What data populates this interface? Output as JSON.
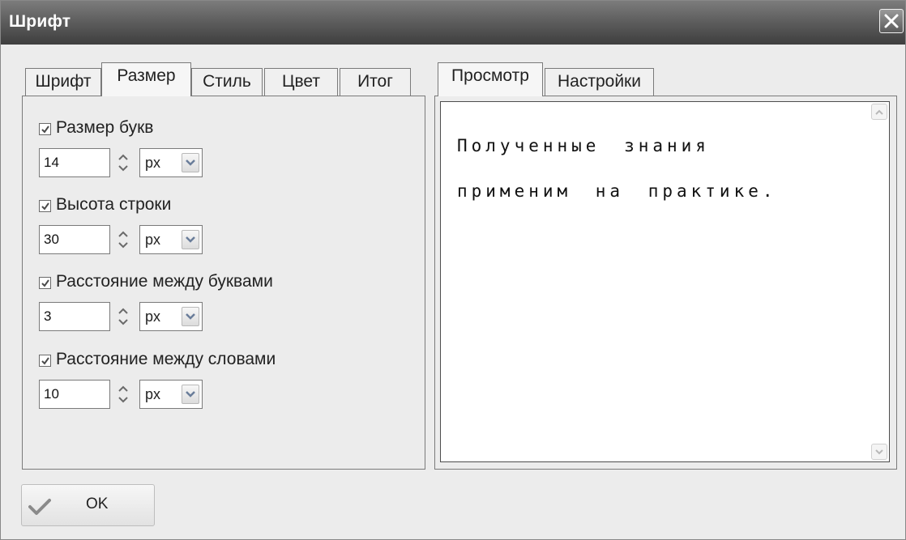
{
  "window": {
    "title": "Шрифт"
  },
  "left_tabs": [
    {
      "label": "Шрифт",
      "active": false
    },
    {
      "label": "Размер",
      "active": true
    },
    {
      "label": "Стиль",
      "active": false
    },
    {
      "label": "Цвет",
      "active": false
    },
    {
      "label": "Итог",
      "active": false
    }
  ],
  "right_tabs": [
    {
      "label": "Просмотр",
      "active": true
    },
    {
      "label": "Настройки",
      "active": false
    }
  ],
  "size_settings": [
    {
      "label": "Размер букв",
      "checked": true,
      "value": "14",
      "unit": "px"
    },
    {
      "label": "Высота строки",
      "checked": true,
      "value": "30",
      "unit": "px"
    },
    {
      "label": "Расстояние между буквами",
      "checked": true,
      "value": "3",
      "unit": "px"
    },
    {
      "label": "Расстояние между словами",
      "checked": true,
      "value": "10",
      "unit": "px"
    }
  ],
  "preview": {
    "lines": [
      "Полученные знания",
      "применим на практике."
    ]
  },
  "footer": {
    "ok_label": "OK"
  },
  "icons": {
    "close": "close-icon",
    "checkmark": "checkmark-icon",
    "spinner_up": "spinner-up-icon",
    "spinner_down": "spinner-down-icon",
    "dropdown": "chevron-down-icon",
    "scroll_up": "scroll-up-icon",
    "scroll_down": "scroll-down-icon"
  },
  "colors": {
    "titlebar_top": "#7c7c7c",
    "titlebar_bottom": "#3e3e3e",
    "panel_bg": "#ececec",
    "ok_check": "#8a8a8a"
  }
}
